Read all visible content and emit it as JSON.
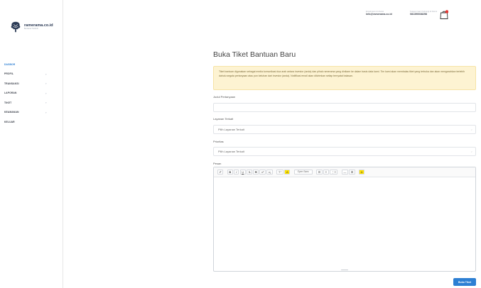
{
  "brand": {
    "name": "ramerama.co.id",
    "tagline": "Bersama Tumbuh"
  },
  "sidebar": {
    "items": [
      {
        "label": "DASBOR",
        "active": true,
        "has_children": false
      },
      {
        "label": "PROFIL",
        "active": false,
        "has_children": true
      },
      {
        "label": "TRANSAKSI",
        "active": false,
        "has_children": true
      },
      {
        "label": "LAPORAN",
        "active": false,
        "has_children": true
      },
      {
        "label": "TIKET",
        "active": false,
        "has_children": true
      },
      {
        "label": "KEAMANAN",
        "active": false,
        "has_children": true
      },
      {
        "label": "KELUAR",
        "active": false,
        "has_children": false
      }
    ],
    "chevron": "›"
  },
  "header": {
    "email_label": "Email kami di disnisi",
    "email_value": "info@ramerama.co.id",
    "phone_label": "Telepon kami hubungi di bisnis",
    "phone_value": "081390038258",
    "cart_icon": "shopping-bag-icon"
  },
  "page": {
    "title": "Buka Tiket Bantuan Baru",
    "notice": "Tiket bantuan digunakan sebagai media komunikasi dua arah antara investor (anda) dan pihak ramerama yang dinikam ke dalam basis data kami. Tim kami akan membalas tiket yang terbuka dan akan mengarahkan terlebih dahulu segala pertanyaan atau pun keluhan dari investor (anda). Notifikasi email akan dikirimkan setiap ternyatal balasan.",
    "subject_label": "Judul Pertanyaan",
    "subject_value": "",
    "service_label": "Layanan Terkait",
    "service_value": "Pilih Layanan Terkait",
    "priority_label": "Prioritas",
    "priority_value": "Pilih Layanan Terkait",
    "message_label": "Pesan",
    "submit_label": "Buka Tiket"
  },
  "editor": {
    "toolbar": [
      "✐",
      "B",
      "I",
      "U",
      "S̶",
      "S",
      "x²",
      "x₂",
      "T⁺",
      "A",
      "Open Sans",
      "☰",
      "≡",
      "⋮≡",
      "—",
      "⊞",
      "A"
    ]
  },
  "colors": {
    "accent": "#2d7fd3",
    "notice_bg": "#fdf3d2",
    "badge": "#e53935"
  }
}
